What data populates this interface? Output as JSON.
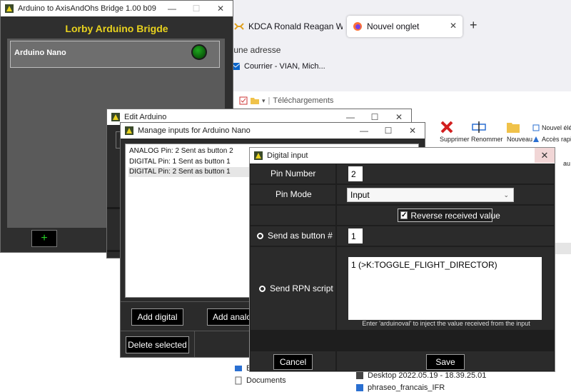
{
  "browser": {
    "tabs": [
      {
        "label": "KDCA Ronald Reagan Washingt",
        "active": false
      },
      {
        "label": "Nouvel onglet",
        "active": true
      }
    ],
    "new_tab": "+",
    "address_placeholder": "r une adresse",
    "bookmark": "Courrier - VIAN, Mich..."
  },
  "explorer": {
    "title": "Téléchargements",
    "ribbon": {
      "delete": "Supprimer",
      "rename": "Renommer",
      "new_folder": "Nouveau",
      "new_item": "Nouvel élé",
      "quick_access": "Accès rapi"
    },
    "col_partial": "au",
    "sidebar_partial": "B",
    "documents": "Documents",
    "files": [
      "Desktop 2022.05.19 - 18.39.25.01",
      "phraseo_francais_IFR"
    ]
  },
  "main_window": {
    "title": "Arduino to AxisAndOhs Bridge 1.00 b09",
    "heading": "Lorby Arduino Brigde",
    "device": "Arduino Nano",
    "add_label": "+"
  },
  "edit_window": {
    "title": "Edit Arduino"
  },
  "manage_window": {
    "title": "Manage inputs for Arduino Nano",
    "inputs": [
      {
        "label": "ANALOG Pin: 2 Sent as button 2",
        "selected": false
      },
      {
        "label": "DIGITAL Pin: 1 Sent as button 1",
        "selected": false
      },
      {
        "label": "DIGITAL Pin: 2 Sent as button 1",
        "selected": true
      }
    ],
    "add_digital": "Add digital",
    "add_analog": "Add analo",
    "delete_selected": "Delete selected"
  },
  "dialog": {
    "title": "Digital input",
    "close": "✕",
    "pin_number_label": "Pin Number",
    "pin_number_value": "2",
    "pin_mode_label": "Pin Mode",
    "pin_mode_value": "Input",
    "reverse_label": "Reverse received value",
    "reverse_checked": true,
    "send_button_label": "Send as button #",
    "send_button_value": "1",
    "send_rpn_label": "Send RPN script",
    "rpn_script": "1 (>K:TOGGLE_FLIGHT_DIRECTOR)",
    "hint": "Enter 'arduinoval' to inject the value received from the input",
    "cancel": "Cancel",
    "save": "Save"
  },
  "colors": {
    "heading_yellow": "#e8d21e",
    "led_green": "#1fa81f",
    "plus_green": "#27d027",
    "dialog_bg": "#1e1e1e",
    "cell_bg": "#2b2b2b"
  }
}
